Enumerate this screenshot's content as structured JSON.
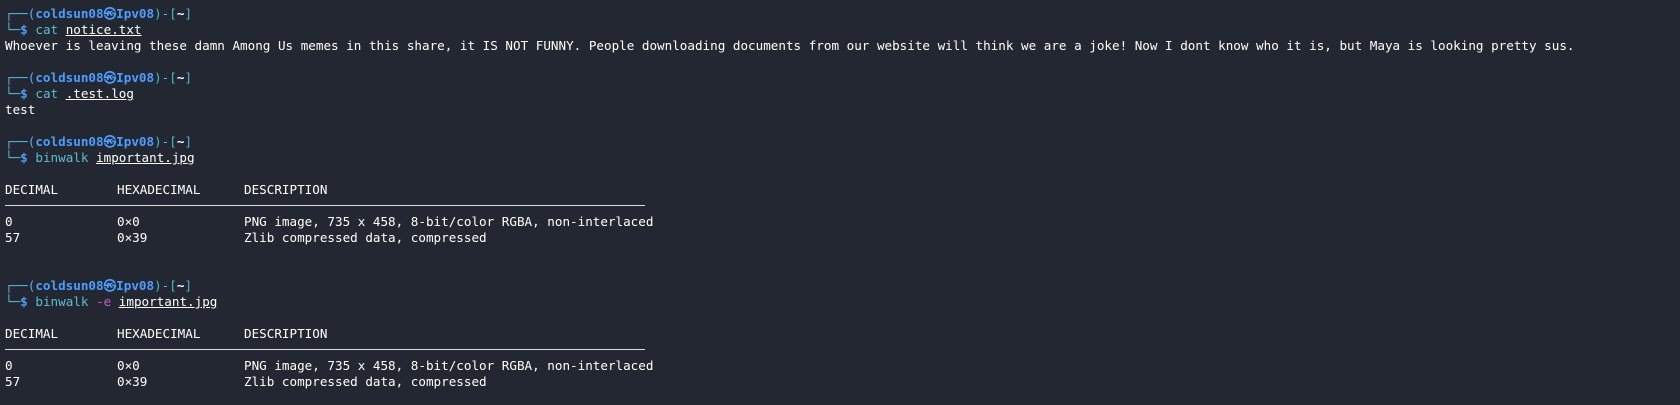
{
  "prompt": {
    "user_host": "coldsun08㉿Ipv08",
    "dir": "~",
    "dollar": "$"
  },
  "blocks": [
    {
      "command": "cat",
      "flag": "",
      "arg": "notice.txt",
      "output": "Whoever is leaving these damn Among Us memes in this share, it IS NOT FUNNY. People downloading documents from our website will think we are a joke! Now I dont know who it is, but Maya is looking pretty sus."
    },
    {
      "command": "cat",
      "flag": "",
      "arg": ".test.log",
      "output": "test"
    },
    {
      "command": "binwalk",
      "flag": "",
      "arg": "important.jpg",
      "table": {
        "headers": [
          "DECIMAL",
          "HEXADECIMAL",
          "DESCRIPTION"
        ],
        "rows": [
          [
            "0",
            "0×0",
            "PNG image, 735 x 458, 8-bit/color RGBA, non-interlaced"
          ],
          [
            "57",
            "0×39",
            "Zlib compressed data, compressed"
          ]
        ]
      }
    },
    {
      "command": "binwalk",
      "flag": "-e",
      "arg": "important.jpg",
      "table": {
        "headers": [
          "DECIMAL",
          "HEXADECIMAL",
          "DESCRIPTION"
        ],
        "rows": [
          [
            "0",
            "0×0",
            "PNG image, 735 x 458, 8-bit/color RGBA, non-interlaced"
          ],
          [
            "57",
            "0×39",
            "Zlib compressed data, compressed"
          ]
        ]
      }
    }
  ]
}
